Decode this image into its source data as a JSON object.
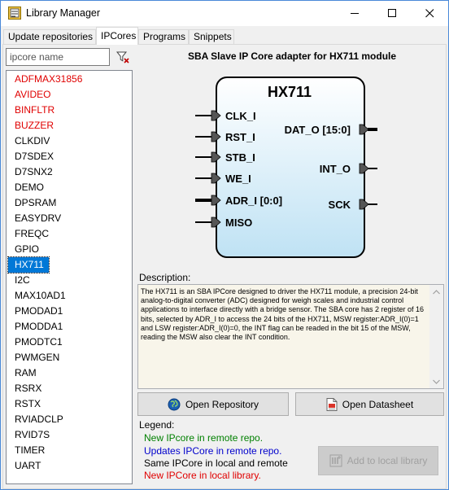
{
  "window": {
    "title": "Library Manager",
    "controls": [
      "minimize",
      "maximize",
      "close"
    ]
  },
  "tabs": [
    {
      "label": "Update repositories",
      "active": false
    },
    {
      "label": "IPCores",
      "active": true
    },
    {
      "label": "Programs",
      "active": false
    },
    {
      "label": "Snippets",
      "active": false
    }
  ],
  "filter": {
    "placeholder": "ipcore name",
    "value": ""
  },
  "list": {
    "items": [
      {
        "label": "ADFMAX31856",
        "status": "local-only"
      },
      {
        "label": "AVIDEO",
        "status": "local-only"
      },
      {
        "label": "BINFLTR",
        "status": "local-only"
      },
      {
        "label": "BUZZER",
        "status": "local-only"
      },
      {
        "label": "CLKDIV",
        "status": "same"
      },
      {
        "label": "D7SDEX",
        "status": "same"
      },
      {
        "label": "D7SNX2",
        "status": "same"
      },
      {
        "label": "DEMO",
        "status": "same"
      },
      {
        "label": "DPSRAM",
        "status": "same"
      },
      {
        "label": "EASYDRV",
        "status": "same"
      },
      {
        "label": "FREQC",
        "status": "same"
      },
      {
        "label": "GPIO",
        "status": "same"
      },
      {
        "label": "HX711",
        "status": "same",
        "selected": true
      },
      {
        "label": "I2C",
        "status": "same"
      },
      {
        "label": "MAX10AD1",
        "status": "same"
      },
      {
        "label": "PMODAD1",
        "status": "same"
      },
      {
        "label": "PMODDA1",
        "status": "same"
      },
      {
        "label": "PMODTC1",
        "status": "same"
      },
      {
        "label": "PWMGEN",
        "status": "same"
      },
      {
        "label": "RAM",
        "status": "same"
      },
      {
        "label": "RSRX",
        "status": "same"
      },
      {
        "label": "RSTX",
        "status": "same"
      },
      {
        "label": "RVIADCLP",
        "status": "same"
      },
      {
        "label": "RVID7S",
        "status": "same"
      },
      {
        "label": "TIMER",
        "status": "same"
      },
      {
        "label": "UART",
        "status": "same"
      }
    ]
  },
  "core": {
    "heading": "SBA Slave IP Core adapter for HX711 module",
    "block_name": "HX711",
    "inputs": [
      {
        "label": "CLK_I",
        "bus": false
      },
      {
        "label": "RST_I",
        "bus": false
      },
      {
        "label": "STB_I",
        "bus": false
      },
      {
        "label": "WE_I",
        "bus": false
      },
      {
        "label": "ADR_I [0:0]",
        "bus": true
      },
      {
        "label": "MISO",
        "bus": false
      }
    ],
    "outputs": [
      {
        "label": "DAT_O [15:0]",
        "bus": true
      },
      {
        "label": "INT_O",
        "bus": false
      },
      {
        "label": "SCK",
        "bus": false
      }
    ]
  },
  "description": {
    "label": "Description:",
    "text": "The HX711 is an SBA IPCore designed to driver the HX711 module, a precision 24-bit analog-to-digital converter (ADC) designed for weigh scales and industrial control applications to interface directly with a bridge sensor. The SBA core has 2 register of 16 bits, selected by  ADR_I to access the 24 bits of the HX711, MSW register:ADR_I(0)=1 and LSW register:ADR_I(0)=0, the INT flag can be readed in the bit 15 of the MSW, reading the MSW also clear the INT condition."
  },
  "buttons": {
    "open_repository": "Open Repository",
    "open_datasheet": "Open Datasheet",
    "add_to_local": "Add to local library"
  },
  "legend": {
    "title": "Legend:",
    "items": [
      {
        "text": "New IPcore in remote repo.",
        "color": "#008000"
      },
      {
        "text": "Updates IPCore in remote repo.",
        "color": "#0000cc"
      },
      {
        "text": "Same IPCore in local and remote",
        "color": "#000000"
      },
      {
        "text": "New IPCore in local library.",
        "color": "#e00000"
      }
    ]
  },
  "colors": {
    "local_only": "#e00000",
    "selection": "#0078d7",
    "block_fill": "#cfeaf7"
  }
}
